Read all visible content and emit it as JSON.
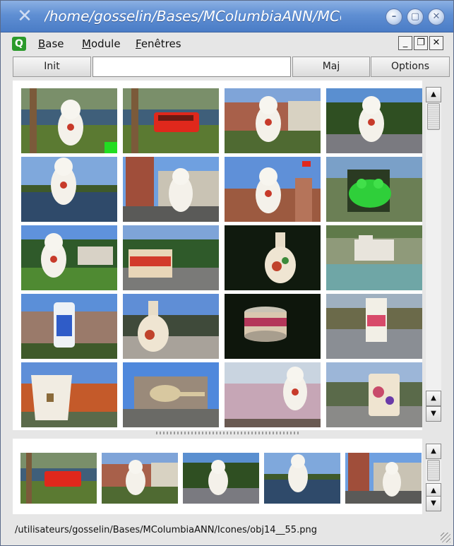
{
  "window": {
    "title": "/home/gosselin/Bases/MColumbiaANN/MColumbia/",
    "icon": "x-window-icon",
    "controls": [
      "minimize-icon",
      "maximize-icon",
      "close-icon"
    ]
  },
  "menubar": {
    "items": [
      {
        "label": "Base",
        "accel": "B",
        "rest": "ase"
      },
      {
        "label": "Module",
        "accel": "M",
        "rest": "odule"
      },
      {
        "label": "Fenêtres",
        "accel": "F",
        "rest": "enêtres"
      }
    ],
    "mdi_controls": [
      "minimize-icon",
      "restore-icon",
      "close-icon"
    ]
  },
  "toolbar": {
    "init_label": "Init",
    "search_value": "",
    "maj_label": "Maj",
    "options_label": "Options"
  },
  "grid": {
    "rows": [
      [
        "cat-lake",
        "bus-lake",
        "cat-buildings",
        "cat-trees-road"
      ],
      [
        "cat-lake-2",
        "cat-tower-building",
        "cat-flags",
        "green-frog"
      ],
      [
        "cat-houses",
        "tylenol-box",
        "vase-dark",
        "white-object-ground"
      ],
      [
        "bottle-buildings",
        "vase-rocks",
        "can-dark",
        "carton-street"
      ],
      [
        "cup-trees",
        "scoop-building",
        "cat-blossom",
        "mug-road"
      ]
    ],
    "selected_marker_color": "#22dd22"
  },
  "strip": {
    "items": [
      "bus-lake",
      "cat-buildings",
      "cat-trees-road",
      "cat-lake-2",
      "cat-tower-building"
    ]
  },
  "status": {
    "path": "/utilisateurs/gosselin/Bases/MColumbiaANN/Icones/obj14__55.png"
  },
  "colors": {
    "titlebar": "#5f8fd3",
    "selection": "#22dd22"
  }
}
